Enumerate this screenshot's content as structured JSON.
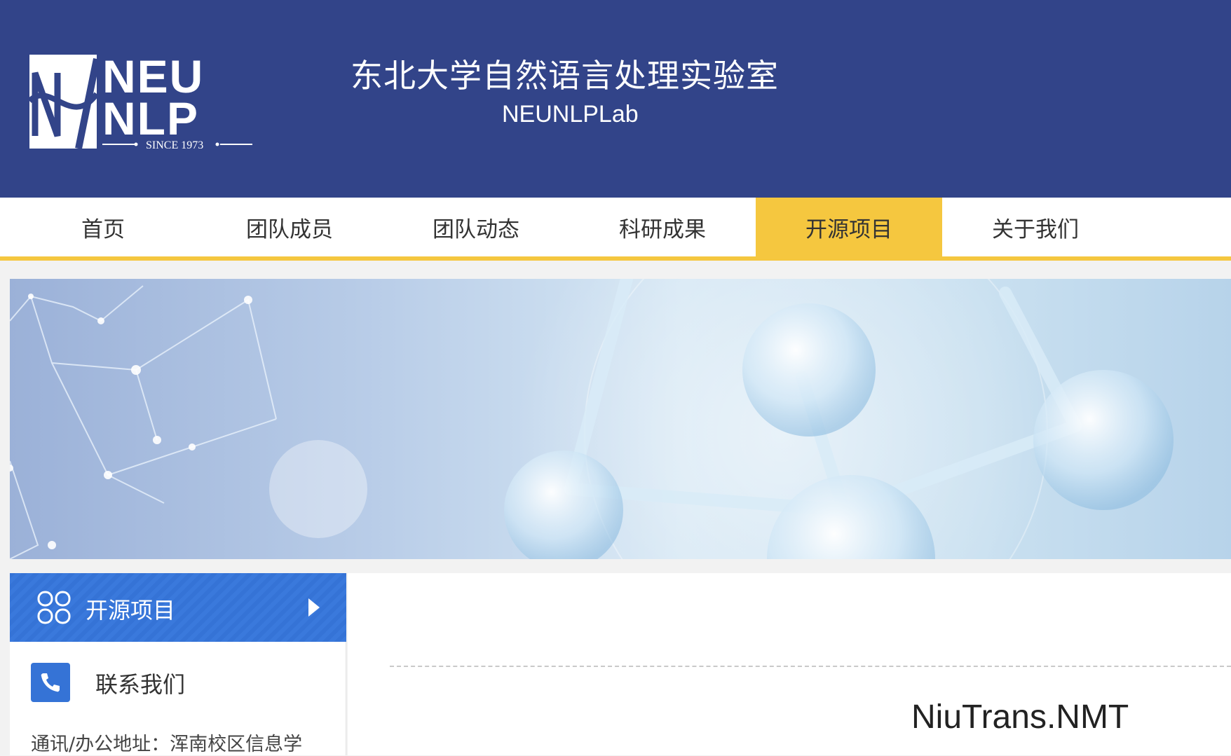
{
  "header": {
    "title": "东北大学自然语言处理实验室",
    "subtitle": "NEUNLPLab",
    "logo": {
      "line1": "NEU",
      "line2": "NLP",
      "tagline": "SINCE 1973"
    }
  },
  "nav": {
    "items": [
      {
        "label": "首页"
      },
      {
        "label": "团队成员"
      },
      {
        "label": "团队动态"
      },
      {
        "label": "科研成果"
      },
      {
        "label": "开源项目"
      },
      {
        "label": "关于我们"
      }
    ],
    "active_index": 4
  },
  "sidebar": {
    "section_title": "开源项目",
    "section_icon": "grid-icon",
    "arrow_icon": "caret-right-icon",
    "contact_title": "联系我们",
    "contact_icon": "phone-icon",
    "address": "通讯/办公地址：浑南校区信息学"
  },
  "main": {
    "project_title": "NiuTrans.NMT"
  },
  "colors": {
    "header_bg": "#324489",
    "accent_yellow": "#f5c73f",
    "sidebar_blue": "#3573d6"
  }
}
